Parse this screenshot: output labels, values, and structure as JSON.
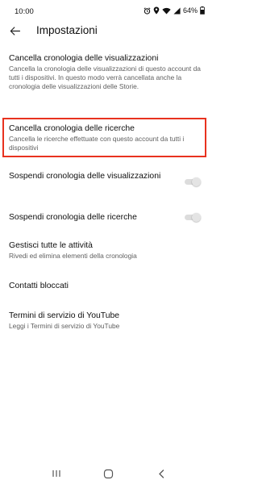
{
  "status_bar": {
    "time": "10:00",
    "battery": "64%",
    "icons": [
      "alarm-icon",
      "location-icon",
      "wifi-icon",
      "signal-icon",
      "battery-icon"
    ]
  },
  "header": {
    "title": "Impostazioni",
    "back_icon": "arrow-left-icon"
  },
  "settings": {
    "clear_watch_history": {
      "title": "Cancella cronologia delle visualizzazioni",
      "description": "Cancella la cronologia delle visualizzazioni di questo account da tutti i dispositivi. In questo modo verrà cancellata anche la cronologia delle visualizzazioni delle Storie."
    },
    "clear_search_history": {
      "title": "Cancella cronologia delle ricerche",
      "description": "Cancella le ricerche effettuate con questo account da tutti i dispositivi"
    },
    "pause_watch_history": {
      "title": "Sospendi cronologia delle visualizzazioni",
      "enabled": false
    },
    "pause_search_history": {
      "title": "Sospendi cronologia delle ricerche",
      "enabled": false
    },
    "manage_activity": {
      "title": "Gestisci tutte le attività",
      "description": "Rivedi ed elimina elementi della cronologia"
    },
    "blocked_contacts": {
      "title": "Contatti bloccati"
    },
    "youtube_terms": {
      "title": "Termini di servizio di YouTube",
      "description": "Leggi i Termini di servizio di YouTube"
    }
  },
  "colors": {
    "highlight": "#e8321f",
    "primary_text": "#0f0f0f",
    "secondary_text": "#606060",
    "toggle_off": "#dcdcdc"
  },
  "nav_bar": {
    "icons": [
      "recent-apps-icon",
      "home-icon",
      "back-icon"
    ]
  }
}
